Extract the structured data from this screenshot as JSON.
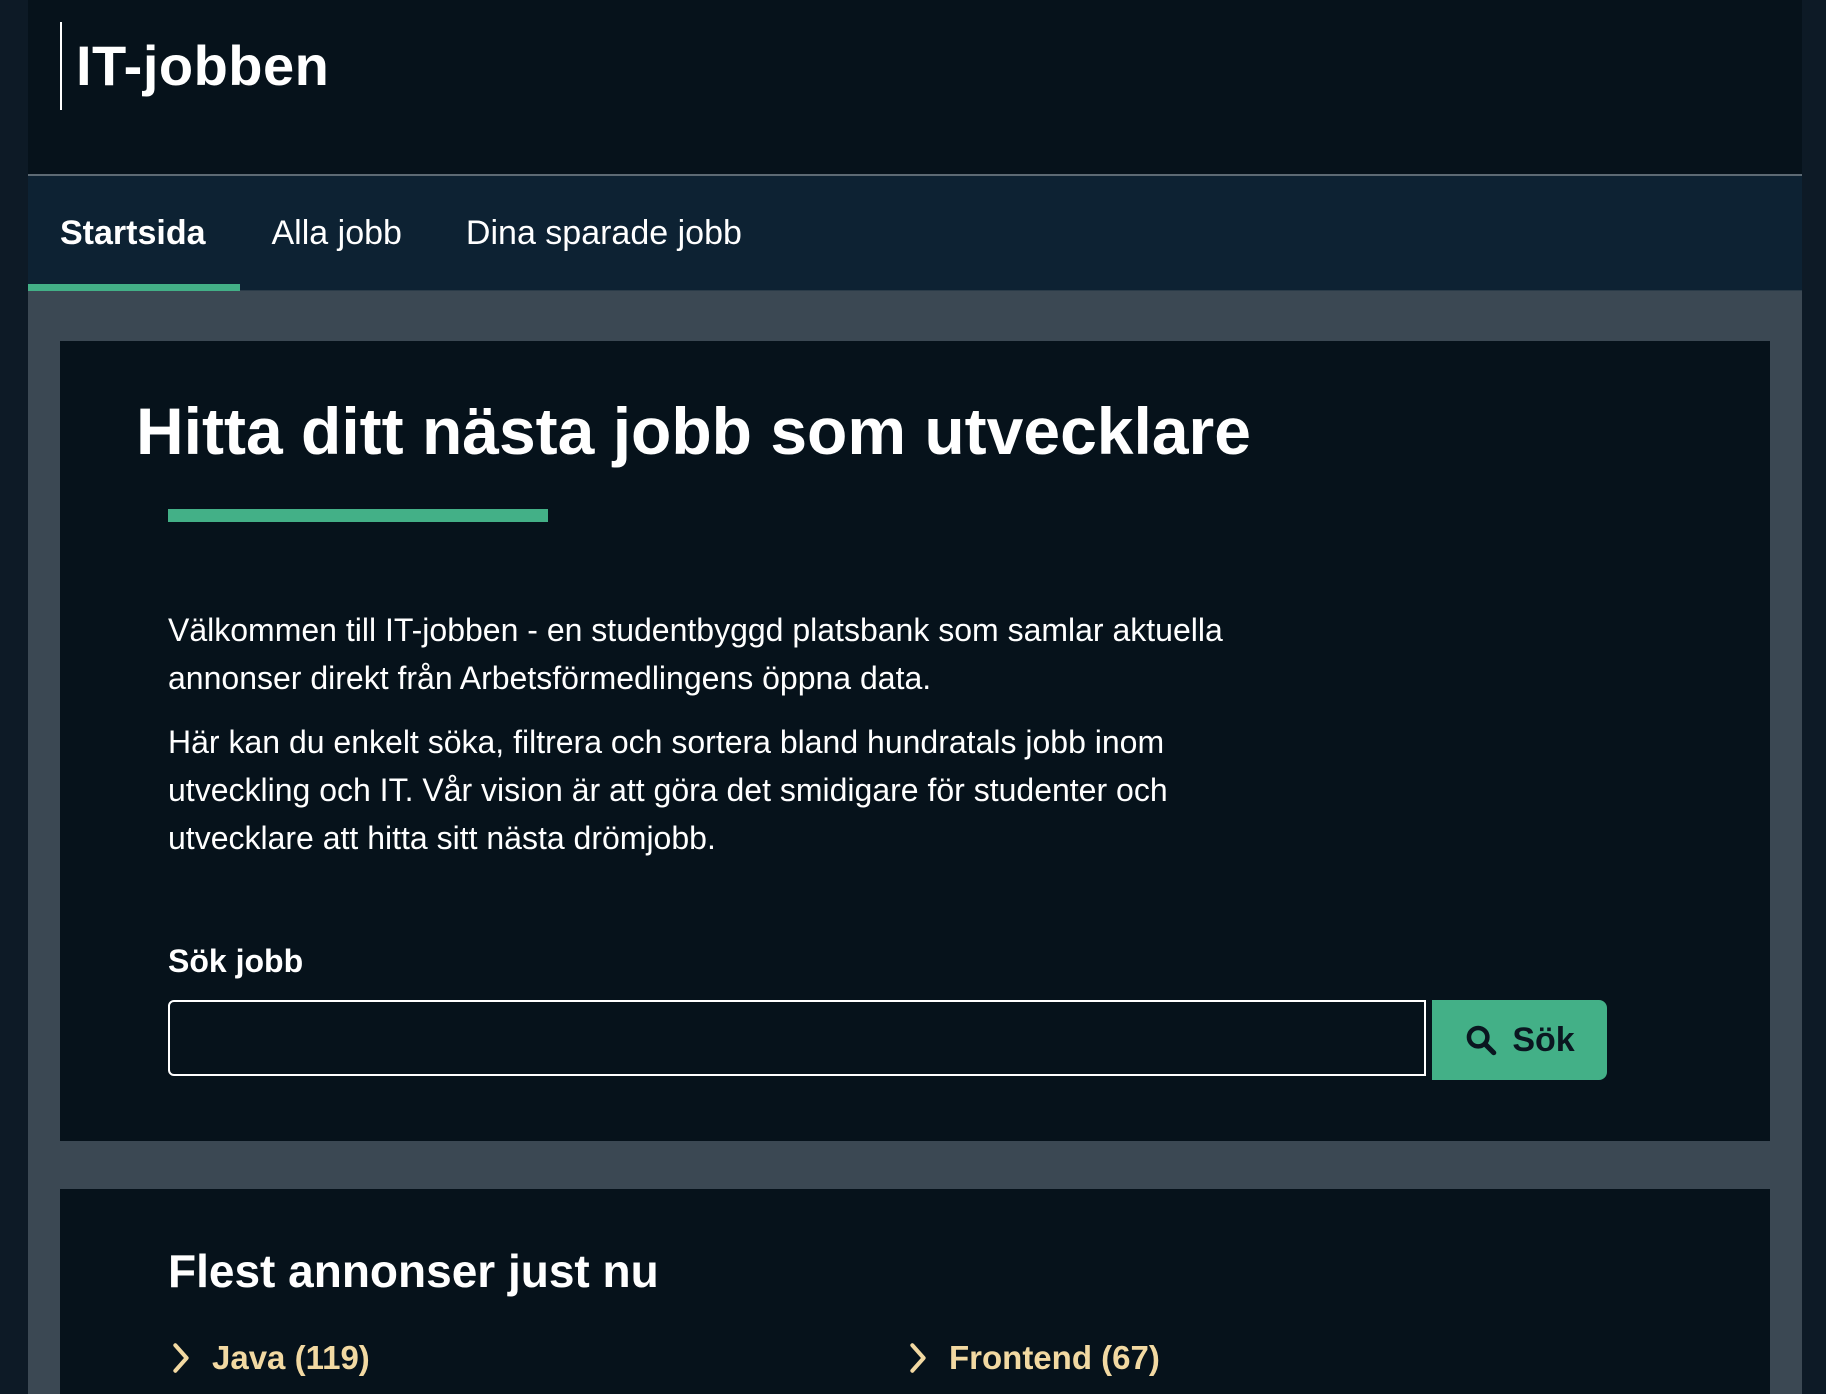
{
  "site": {
    "logo": "IT-jobben"
  },
  "nav": {
    "items": [
      {
        "label": "Startsida",
        "active": true
      },
      {
        "label": "Alla jobb",
        "active": false
      },
      {
        "label": "Dina sparade jobb",
        "active": false
      }
    ]
  },
  "hero": {
    "title": "Hitta ditt nästa jobb som utvecklare",
    "intro_1": "Välkommen till IT-jobben - en studentbyggd platsbank som samlar aktuella annonser direkt från Arbetsförmedlingens öppna data.",
    "intro_2": "Här kan du enkelt söka, filtrera och sortera bland hundratals jobb inom utveckling och IT. Vår vision är att göra det smidigare för studenter och utvecklare att hitta sitt nästa drömjobb."
  },
  "search": {
    "label": "Sök jobb",
    "value": "",
    "button_label": "Sök",
    "button_icon": "search-icon"
  },
  "popular": {
    "title": "Flest annonser just nu",
    "items": [
      {
        "label": "Java (119)",
        "icon": "chevron-right-icon"
      },
      {
        "label": "Frontend (67)",
        "icon": "chevron-right-icon"
      }
    ]
  },
  "colors": {
    "background": "#3b4853",
    "header": "#06121b",
    "nav": "#0d2233",
    "card": "#06121b",
    "accent": "#43b087",
    "link": "#f2d9a2",
    "text": "#ffffff"
  }
}
